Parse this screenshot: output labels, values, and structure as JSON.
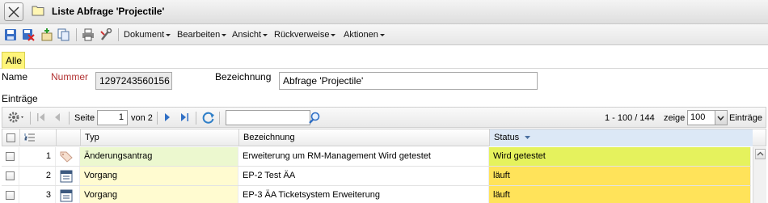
{
  "window": {
    "title": "Liste Abfrage 'Projectile'"
  },
  "toolbar": {
    "menus": [
      "Dokument",
      "Bearbeiten",
      "Ansicht",
      "Rückverweise",
      "Aktionen"
    ]
  },
  "tabs": [
    {
      "label": "Alle"
    }
  ],
  "form": {
    "name_label": "Name",
    "nummer_label": "Nummer",
    "nummer_value": "1297243560156",
    "bezeichnung_label": "Bezeichnung",
    "bezeichnung_value": "Abfrage 'Projectile'",
    "eintraege_label": "Einträge"
  },
  "pager": {
    "seite_label": "Seite",
    "page_value": "1",
    "of_label": "von 2",
    "search_value": "",
    "range_text": "1 - 100 / 144",
    "zeige_label": "zeige",
    "page_size": "100",
    "eintraege_label": "Einträge"
  },
  "table": {
    "columns": [
      "Typ",
      "Bezeichnung",
      "Status"
    ],
    "rows": [
      {
        "num": "1",
        "typ": "Änderungsantrag",
        "bezeichnung": "Erweiterung um RM-Management Wird getestet",
        "status": "Wird getestet",
        "icon": "tag-icon"
      },
      {
        "num": "2",
        "typ": "Vorgang",
        "bezeichnung": "EP-2 Test ÄA",
        "status": "läuft",
        "icon": "calendar-icon"
      },
      {
        "num": "3",
        "typ": "Vorgang",
        "bezeichnung": "EP-3 ÄA Ticketsystem Erweiterung",
        "status": "läuft",
        "icon": "calendar-icon"
      }
    ]
  },
  "colors": {
    "accent_yellow": "#fff57a",
    "row_type_bg": "#fffbd0",
    "row1_green": "#ecf8cf",
    "status_lime": "#e5f25d",
    "status_yellow": "#ffe35a",
    "link_blue": "#2f6fc5"
  }
}
